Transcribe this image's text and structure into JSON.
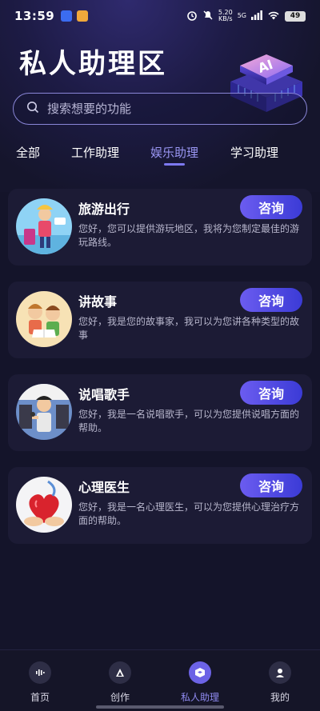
{
  "status_bar": {
    "time": "13:59",
    "network_speed": "5.20",
    "network_unit": "KB/s",
    "signal": "5G",
    "battery": "49"
  },
  "page_title": "私人助理区",
  "search": {
    "placeholder": "搜索想要的功能"
  },
  "tabs": [
    {
      "label": "全部",
      "active": false
    },
    {
      "label": "工作助理",
      "active": false
    },
    {
      "label": "娱乐助理",
      "active": true
    },
    {
      "label": "学习助理",
      "active": false
    }
  ],
  "cards": [
    {
      "title": "旅游出行",
      "description": "您好，您可以提供游玩地区，我将为您制定最佳的游玩路线。",
      "button": "咨询",
      "avatar_icon": "travel-avatar"
    },
    {
      "title": "讲故事",
      "description": "您好，我是您的故事家，我可以为您讲各种类型的故事",
      "button": "咨询",
      "avatar_icon": "story-avatar"
    },
    {
      "title": "说唱歌手",
      "description": "您好，我是一名说唱歌手，可以为您提供说唱方面的帮助。",
      "button": "咨询",
      "avatar_icon": "rapper-avatar"
    },
    {
      "title": "心理医生",
      "description": "您好，我是一名心理医生，可以为您提供心理治疗方面的帮助。",
      "button": "咨询",
      "avatar_icon": "heart-avatar"
    }
  ],
  "bottom_nav": [
    {
      "label": "首页",
      "icon": "home-icon",
      "active": false
    },
    {
      "label": "创作",
      "icon": "create-icon",
      "active": false
    },
    {
      "label": "私人助理",
      "icon": "assistant-icon",
      "active": true
    },
    {
      "label": "我的",
      "icon": "profile-icon",
      "active": false
    }
  ],
  "colors": {
    "background": "#14142a",
    "card": "#1c1b35",
    "accent": "#6b5cf0",
    "active_tab": "#9a96f3"
  }
}
